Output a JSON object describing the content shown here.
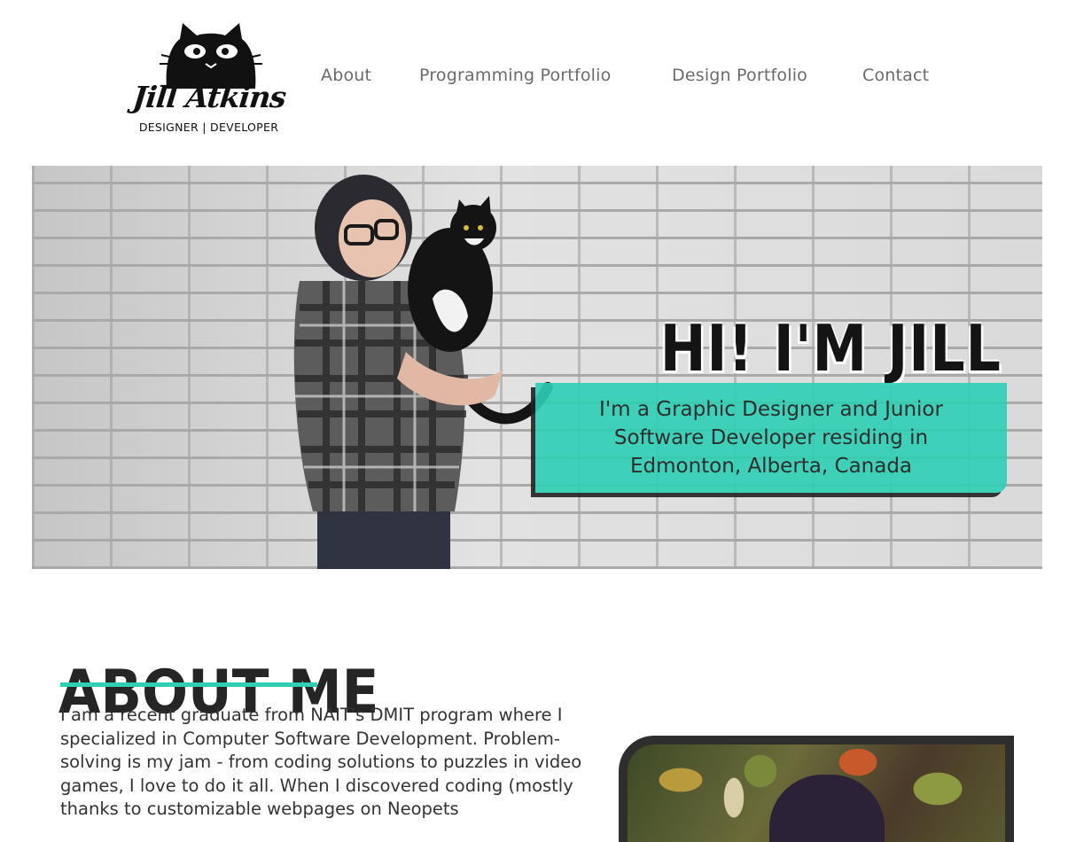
{
  "header": {
    "logo": {
      "name": "Jill Atkins",
      "tagline": "DESIGNER | DEVELOPER"
    },
    "nav": [
      {
        "label": "About"
      },
      {
        "label": "Programming Portfolio"
      },
      {
        "label": "Design Portfolio"
      },
      {
        "label": "Contact"
      }
    ]
  },
  "hero": {
    "title": "HI! I'M JILL",
    "subtitle": "I'm a Graphic Designer and Junior Software Developer residing in Edmonton, Alberta, Canada"
  },
  "about": {
    "heading": "ABOUT ME",
    "body": "I am a recent graduate from NAIT's DMIT program where I specialized in Computer Software Development. Problem-solving is my jam - from coding solutions to puzzles in video games, I love to do it all. When I discovered coding (mostly thanks to customizable webpages on Neopets"
  },
  "colors": {
    "accent": "#2ecfb5",
    "nav_text": "#6b6b6b",
    "heading": "#252525"
  }
}
